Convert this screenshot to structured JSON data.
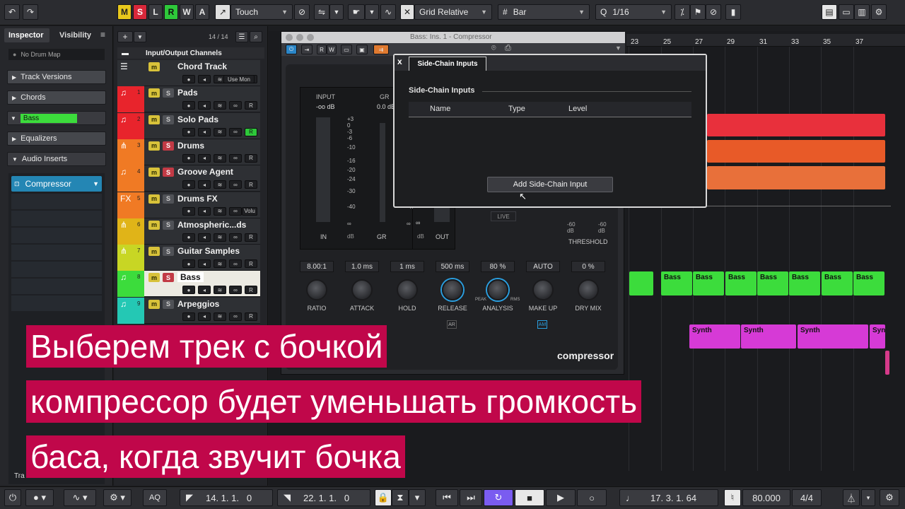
{
  "toolbar": {
    "undo_icon": "undo-icon",
    "redo_icon": "redo-icon",
    "modes": [
      "M",
      "S",
      "L",
      "R",
      "W",
      "A"
    ],
    "automation_mode": "Touch",
    "grid_type": "Grid Relative",
    "grid_unit": "Bar",
    "quantize": "1/16"
  },
  "inspector": {
    "tab_inspector": "Inspector",
    "tab_visibility": "Visibility",
    "drum_map": "No Drum Map",
    "sections": [
      "Track Versions",
      "Chords",
      "Bass",
      "Equalizers",
      "Audio Inserts"
    ],
    "insert_slot": "Compressor"
  },
  "track_list": {
    "count": "14 / 14",
    "folder": "Input/Output Channels",
    "tracks": [
      {
        "num": "",
        "name": "Chord Track",
        "color": "#2e3034"
      },
      {
        "num": "1",
        "name": "Pads",
        "color": "#e8242c"
      },
      {
        "num": "2",
        "name": "Solo Pads",
        "color": "#e8242c"
      },
      {
        "num": "3",
        "name": "Drums",
        "color": "#f07a24"
      },
      {
        "num": "4",
        "name": "Groove Agent",
        "color": "#f07a24"
      },
      {
        "num": "5",
        "name": "Drums FX",
        "color": "#f07a24"
      },
      {
        "num": "6",
        "name": "Atmospheric...ds",
        "color": "#e0b418"
      },
      {
        "num": "7",
        "name": "Guitar Samples",
        "color": "#c8d624"
      },
      {
        "num": "8",
        "name": "Bass",
        "color": "#3cdc3c"
      },
      {
        "num": "9",
        "name": "Arpeggios",
        "color": "#24c8b4"
      }
    ],
    "chord_use": "Use Mon",
    "fx_vol": "Volu"
  },
  "plugin": {
    "window_title": "Bass: Ins. 1 - Compressor",
    "meter_input": "INPUT",
    "meter_input_val": "-oo dB",
    "meter_gr": "GR",
    "meter_gr_val": "0.0 dB",
    "scale": [
      "+3",
      "0",
      "-3",
      "-6",
      "-10",
      "-16",
      "-20",
      "-24",
      "-30",
      "-40",
      "∞"
    ],
    "meter_in": "IN",
    "meter_db": "dB",
    "meter_gr2": "GR",
    "meter_db2": "dB",
    "meter_out": "OUT",
    "live": "LIVE",
    "threshold": "THRESHOLD",
    "thr_l": "-60\ndB",
    "thr_r": "-60\ndB",
    "values": [
      "8.00:1",
      "1.0 ms",
      "1 ms",
      "500 ms",
      "80 %",
      "AUTO",
      "0 %"
    ],
    "knobs": [
      "RATIO",
      "ATTACK",
      "HOLD",
      "RELEASE",
      "ANALYSIS",
      "MAKE UP",
      "DRY MIX"
    ],
    "peak": "PEAK",
    "rms": "RMS",
    "ar": "AR",
    "am": "AM",
    "brand": "compressor"
  },
  "sidechain": {
    "close": "x",
    "tab": "Side-Chain Inputs",
    "heading": "Side-Chain Inputs",
    "columns": [
      "Name",
      "Type",
      "Level"
    ],
    "add_button": "Add Side-Chain Input"
  },
  "ruler": [
    "23",
    "25",
    "27",
    "29",
    "31",
    "33",
    "35",
    "37"
  ],
  "clips": {
    "bass": "Bass",
    "synth": "Synth",
    "synth_short": "Syn"
  },
  "subtitles": [
    "Выберем трек с бочкой",
    "компрессор будет уменьшать громкость",
    "баса, когда звучит бочка"
  ],
  "transport": {
    "aq": "AQ",
    "left_locator": "14. 1. 1.   0",
    "right_locator": "22. 1. 1.   0",
    "position": "17. 3. 1. 64",
    "tempo": "80.000",
    "signature": "4/4",
    "tracks_tab": "Tra"
  },
  "colors": {
    "subtitle_bg": "#c0074a",
    "accent_blue": "#2a9fe0",
    "bass_green": "#3cdc3c",
    "synth_magenta": "#d63ad6"
  }
}
